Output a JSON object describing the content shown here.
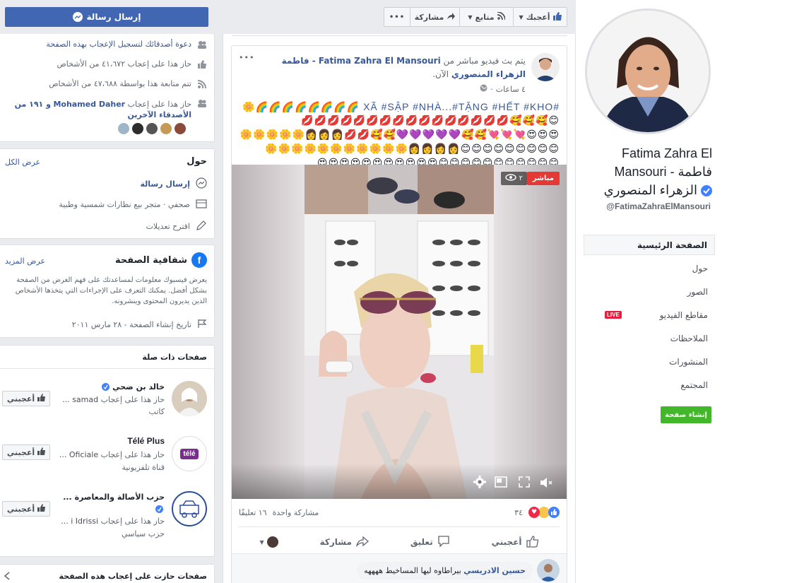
{
  "left": {
    "send_message_btn": "إرسال رسالة",
    "stats": {
      "invite": "دعوة أصدقائك لتسجيل الإعجاب بهذه الصفحة",
      "likes": "حاز هذا على إعجاب ٤١،٦٧٢ من الأشخاص",
      "follows": "تتم متابعة هذا بواسطة ٤٧،٦٨٨ من الأشخاص",
      "friends_like_prefix": "حاز هذا على إعجاب",
      "friends_like_name": "Mohamed Daher",
      "friends_like_suffix": "و ١٩١ من الأصدقاء الآخرين"
    },
    "about": {
      "title": "حول",
      "see_all": "عرض الكل",
      "send_message": "إرسال رسالة",
      "category": "صحفي · متجر بيع نظارات شمسية وطبية",
      "suggest": "اقترح تعديلات"
    },
    "transparency": {
      "title": "شفافية الصفحة",
      "see_more": "عرض المزيد",
      "body": "يعرض فيسبوك معلومات لمساعدتك على فهم الغرض من الصفحة بشكل أفضل. يمكنك التعرف على الإجراءات التي يتخذها الأشخاص الذين يديرون المحتوى وينشرونه.",
      "created": "تاريخ إنشاء الصفحة - ٢٨ مارس ٢٠١١"
    },
    "related": {
      "title": "صفحات ذات صلة",
      "items": [
        {
          "name": "خالد بن ضحي",
          "liked_by": "حاز هذا على إعجاب",
          "liked_name": "samad ...",
          "category": "كاتب",
          "like_btn": "أعجبني"
        },
        {
          "name": "Télé Plus",
          "liked_by": "حاز هذا على إعجاب",
          "liked_name": "Oficiale ...",
          "category": "قناة تلفزيونية",
          "like_btn": "أعجبني"
        },
        {
          "name": "حزب الأصالة والمعاصرة ...",
          "liked_by": "حاز هذا على إعجاب",
          "liked_name": "i Idrissi ...",
          "category": "حزب سياسي",
          "like_btn": "أعجبني"
        }
      ]
    },
    "liked_pages_title": "صفحات حازت على إعجاب هذه الصفحة"
  },
  "toolbar": {
    "more": "•••",
    "share": "مشاركة",
    "follow": "متابع",
    "like": "أعجبك"
  },
  "post": {
    "more": "•••",
    "author": "Fatima Zahra El Mansouri - فاطمة الزهراء المنصوري",
    "live_prefix": "يتم بث فيديو مباشر من",
    "live_suffix": "الآن.",
    "time": "٤ ساعات",
    "text_line1": "#XÃ #SẬP #NHÀ...#TẶNG #HẾT #KHO 🌈🌈🌈🌈🌈🌈🌈🌈🌼",
    "emoji_line2": "😊🥰🥰🥰💋💋💋💋💋💋💋💋💋💋💋💋💋💋💋💋",
    "emoji_line3": "😍😍😍💘💘💘🥰🥰💜💜💜💜💜🥰🥰💋💋👩👩👩🌼🌼🌼🌼🌼",
    "emoji_line4": "😊😊😊😊😊😊😊😊😊👩👩👩👩🌼🌼🌼🌼🌼🌼🌼🌼🌼🌼🌼",
    "emoji_line5": "😊😊😊😊😊😊😊😊😊😊😊😍😍😍😍😍😍😍😍😍😍😍",
    "live_badge": "مباشر",
    "viewers": "٢",
    "reactions_count": "٣٤",
    "comments": "١٦ تعليقًا",
    "shares": "مشاركة واحدة",
    "like_action": "أعجبني",
    "comment_action": "تعليق",
    "share_action": "مشاركة",
    "comment_author": "حسين الادريسي",
    "comment_text": "بيراطاوه ليها المساخيط ههههه"
  },
  "right": {
    "page_name": "Fatima Zahra El Mansouri - فاطمة الزهراء المنصوري",
    "handle": "@FatimaZahraElMansouri",
    "nav": [
      "الصفحة الرئيسية",
      "حول",
      "الصور",
      "مقاطع الفيديو",
      "الملاحظات",
      "المنشورات",
      "المجتمع"
    ],
    "live_tag": "LIVE",
    "create_page": "إنشاء صفحة"
  }
}
